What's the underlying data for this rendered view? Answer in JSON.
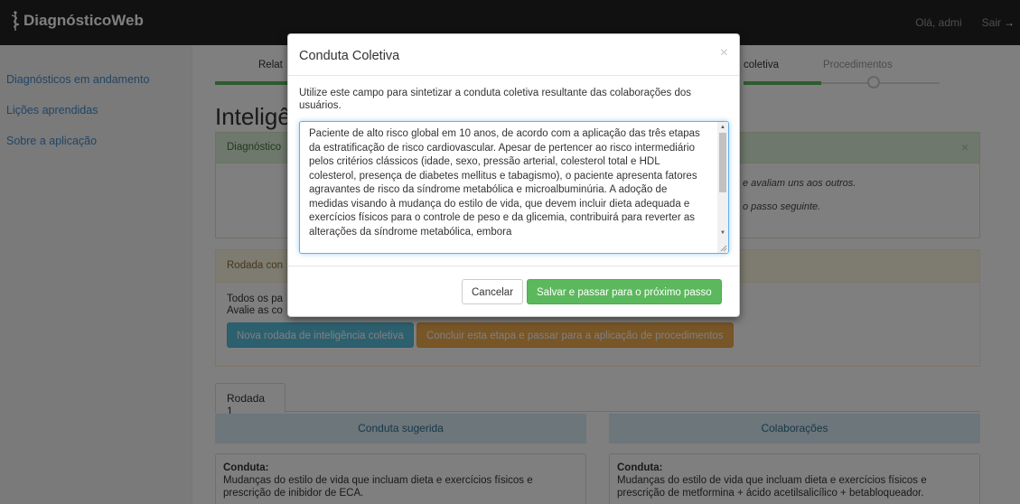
{
  "navbar": {
    "brand": "DiagnósticoWeb",
    "greeting": "Olá, admi",
    "logout": "Sair"
  },
  "sidebar": {
    "items": [
      {
        "label": "Diagnósticos em andamento"
      },
      {
        "label": "Lições aprendidas"
      },
      {
        "label": "Sobre a aplicação"
      }
    ]
  },
  "wizard": {
    "steps": [
      {
        "label": "Relat"
      },
      {
        "label": "coletiva"
      },
      {
        "label": "Procedimentos"
      }
    ]
  },
  "page": {
    "title": "Inteligê"
  },
  "alert": {
    "title": "Diagnóstico",
    "line1": "e avaliam uns aos outros.",
    "line2": "o passo seguinte."
  },
  "round_panel": {
    "title": "Rodada con",
    "line1": "Todos os pa",
    "line2": "Avalie as co",
    "new_round_button": "Nova rodada de inteligência coletiva",
    "conclude_button": "Concluir esta etapa e passar para a aplicação de procedimentos"
  },
  "tabs": {
    "active": "Rodada 1"
  },
  "columns": {
    "left_header": "Conduta sugerida",
    "right_header": "Colaborações",
    "left_card": {
      "label": "Conduta:",
      "text": "Mudanças do estilo de vida que incluam dieta e exercícios físicos e prescrição de inibidor de ECA."
    },
    "right_card": {
      "label": "Conduta:",
      "text": "Mudanças do estilo de vida que incluam dieta e exercícios físicos e prescrição de metformina + ácido acetilsalicílico + betabloqueador."
    }
  },
  "modal": {
    "title": "Conduta Coletiva",
    "close": "×",
    "description": "Utilize este campo para sintetizar a conduta coletiva resultante das colaborações dos usuários.",
    "textarea_value": "Paciente de alto risco global em 10 anos, de acordo com a aplicação das três etapas da estratificação de risco cardiovascular. Apesar de pertencer ao risco intermediário pelos critérios clássicos (idade, sexo, pressão arterial, colesterol total e HDL colesterol, presença de diabetes mellitus e tabagismo), o paciente apresenta fatores agravantes de risco da síndrome metabólica e microalbuminúria. A adoção de medidas visando à mudança do estilo de vida, que devem incluir dieta adequada e exercícios físicos para o controle de peso e da glicemia, contribuirá para reverter as alterações da síndrome metabólica, embora",
    "cancel_button": "Cancelar",
    "save_button": "Salvar e passar para o próximo passo"
  },
  "colors": {
    "navbar": "#222222",
    "link": "#428bca",
    "success": "#5cb85c",
    "info": "#5bc0de",
    "warning": "#f0ad4e"
  }
}
